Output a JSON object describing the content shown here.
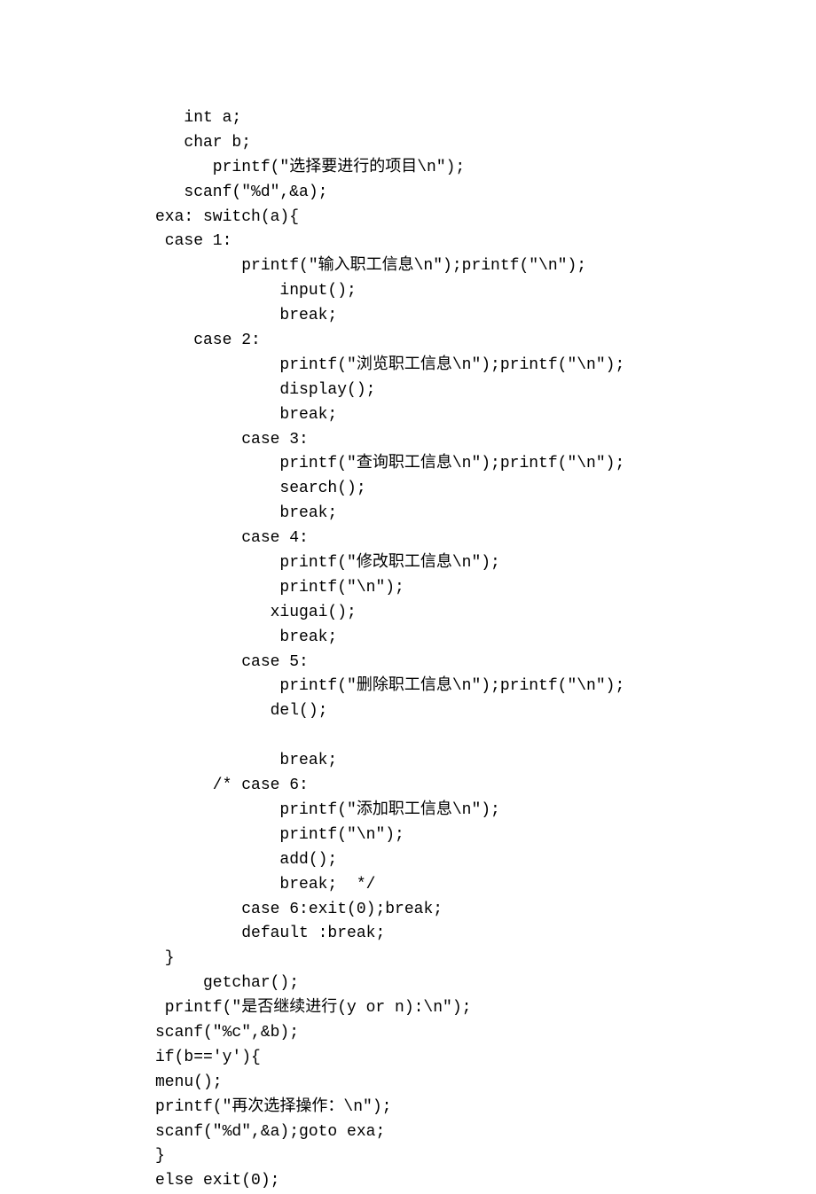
{
  "code_lines": [
    "   int a;",
    "   char b;",
    "      printf(\"选择要进行的项目\\n\");",
    "   scanf(\"%d\",&a);",
    "exa: switch(a){",
    " case 1:",
    "         printf(\"输入职工信息\\n\");printf(\"\\n\");",
    "             input();",
    "             break;",
    "    case 2:",
    "             printf(\"浏览职工信息\\n\");printf(\"\\n\");",
    "             display();",
    "             break;",
    "         case 3:",
    "             printf(\"查询职工信息\\n\");printf(\"\\n\");",
    "             search();",
    "             break;",
    "         case 4:",
    "             printf(\"修改职工信息\\n\");",
    "             printf(\"\\n\");",
    "            xiugai();",
    "             break;",
    "         case 5:",
    "             printf(\"删除职工信息\\n\");printf(\"\\n\");",
    "            del();",
    "",
    "             break;",
    "      /* case 6:",
    "             printf(\"添加职工信息\\n\");",
    "             printf(\"\\n\");",
    "             add();",
    "             break;  */",
    "         case 6:exit(0);break;",
    "         default :break;",
    " }",
    "     getchar();",
    " printf(\"是否继续进行(y or n):\\n\");",
    "scanf(\"%c\",&b);",
    "if(b=='y'){",
    "menu();",
    "printf(\"再次选择操作：\\n\");",
    "scanf(\"%d\",&a);goto exa;",
    "}",
    "else exit(0);"
  ]
}
